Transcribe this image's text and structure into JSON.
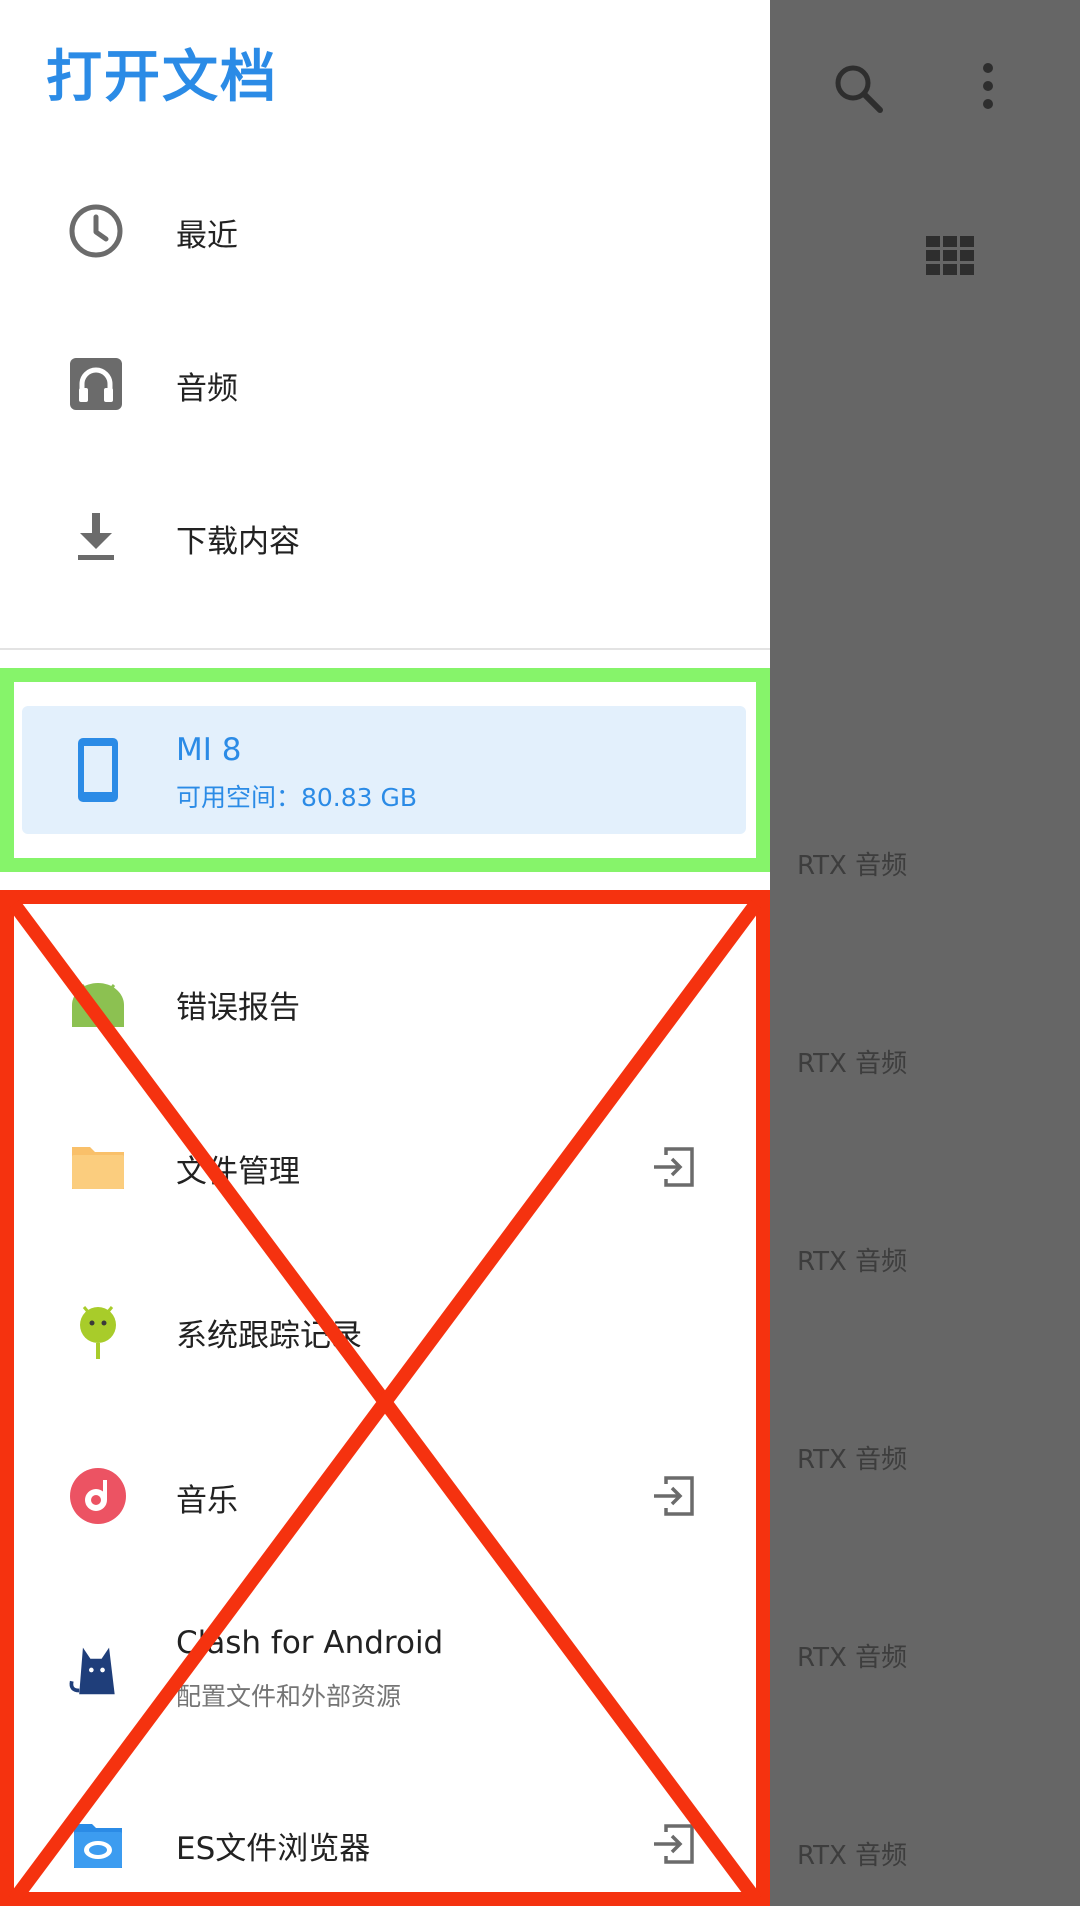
{
  "drawer": {
    "title": "打开文档",
    "roots": [
      {
        "label": "最近",
        "icon": "clock-icon"
      },
      {
        "label": "音频",
        "icon": "headphones-icon"
      },
      {
        "label": "下载内容",
        "icon": "download-icon"
      }
    ],
    "storage": {
      "name": "MI 8",
      "free_space": "可用空间：80.83 GB",
      "icon": "phone-icon"
    },
    "apps": [
      {
        "label": "错误报告",
        "icon": "android-bug-icon"
      },
      {
        "label": "文件管理",
        "icon": "folder-icon",
        "trailing": "open-external-icon"
      },
      {
        "label": "系统跟踪记录",
        "icon": "android-trace-icon"
      },
      {
        "label": "音乐",
        "icon": "music-icon",
        "trailing": "open-external-icon"
      },
      {
        "label": "Clash for Android",
        "sublabel": "配置文件和外部资源",
        "icon": "clash-cat-icon"
      },
      {
        "label": "ES文件浏览器",
        "icon": "es-file-explorer-icon",
        "trailing": "open-external-icon"
      }
    ]
  },
  "background": {
    "icons": [
      "search-icon",
      "more-vertical-icon",
      "grid-view-icon"
    ],
    "list_labels": [
      "RTX 音频",
      "RTX 音频",
      "RTX 音频",
      "RTX 音频",
      "RTX 音频",
      "RTX 音频"
    ]
  },
  "colors": {
    "accent": "#2b8be6",
    "selected_bg": "#e3f0fc",
    "scrim": "#666666",
    "annotation_green": "#86f46a",
    "annotation_red": "#f5320f"
  }
}
